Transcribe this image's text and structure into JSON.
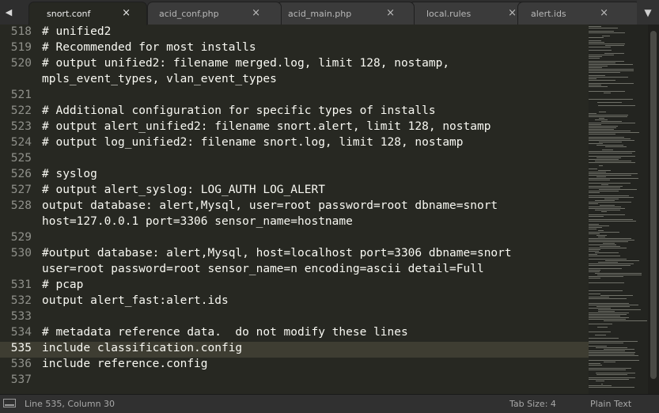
{
  "tabs": [
    {
      "label": "snort.conf",
      "active": true
    },
    {
      "label": "acid_conf.php",
      "active": false
    },
    {
      "label": "acid_main.php",
      "active": false
    },
    {
      "label": "local.rules",
      "active": false
    },
    {
      "label": "alert.ids",
      "active": false
    }
  ],
  "close_glyph": "×",
  "nav": {
    "left_glyph": "◀",
    "right_glyph": "▼"
  },
  "editor": {
    "current_line": "535",
    "lines": [
      {
        "num": "518",
        "text": "# unified2"
      },
      {
        "num": "519",
        "text": "# Recommended for most installs"
      },
      {
        "num": "520",
        "text": "# output unified2: filename merged.log, limit 128, nostamp,"
      },
      {
        "num": "",
        "text": "mpls_event_types, vlan_event_types"
      },
      {
        "num": "521",
        "text": ""
      },
      {
        "num": "522",
        "text": "# Additional configuration for specific types of installs"
      },
      {
        "num": "523",
        "text": "# output alert_unified2: filename snort.alert, limit 128, nostamp"
      },
      {
        "num": "524",
        "text": "# output log_unified2: filename snort.log, limit 128, nostamp"
      },
      {
        "num": "525",
        "text": ""
      },
      {
        "num": "526",
        "text": "# syslog"
      },
      {
        "num": "527",
        "text": "# output alert_syslog: LOG_AUTH LOG_ALERT"
      },
      {
        "num": "528",
        "text": "output database: alert,Mysql, user=root password=root dbname=snort"
      },
      {
        "num": "",
        "text": "host=127.0.0.1 port=3306 sensor_name=hostname"
      },
      {
        "num": "529",
        "text": ""
      },
      {
        "num": "530",
        "text": "#output database: alert,Mysql, host=localhost port=3306 dbname=snort"
      },
      {
        "num": "",
        "text": "user=root password=root sensor_name=n encoding=ascii detail=Full"
      },
      {
        "num": "531",
        "text": "# pcap"
      },
      {
        "num": "532",
        "text": "output alert_fast:alert.ids"
      },
      {
        "num": "533",
        "text": ""
      },
      {
        "num": "534",
        "text": "# metadata reference data.  do not modify these lines"
      },
      {
        "num": "535",
        "text": "include classification.config"
      },
      {
        "num": "536",
        "text": "include reference.config"
      },
      {
        "num": "537",
        "text": ""
      }
    ]
  },
  "status": {
    "position": "Line 535, Column 30",
    "tab_size": "Tab Size: 4",
    "syntax": "Plain Text"
  },
  "colors": {
    "background": "#272822",
    "text": "#f8f8f2",
    "gutter": "#8f908a",
    "current_line": "#3e3d32"
  }
}
